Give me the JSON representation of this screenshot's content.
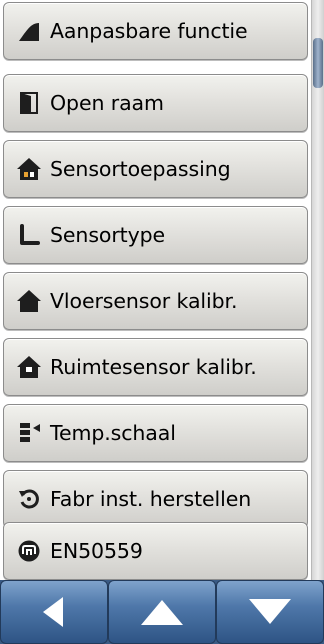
{
  "menu": {
    "items": [
      {
        "label": "Aanpasbare functie",
        "icon": "custom-function-icon"
      },
      {
        "label": "Open raam",
        "icon": "open-window-icon"
      },
      {
        "label": "Sensortoepassing",
        "icon": "house-sensor-icon"
      },
      {
        "label": "Sensortype",
        "icon": "sensor-type-icon"
      },
      {
        "label": "Vloersensor kalibr.",
        "icon": "floor-sensor-house-icon"
      },
      {
        "label": "Ruimtesensor kalibr.",
        "icon": "room-sensor-house-icon"
      },
      {
        "label": "Temp.schaal",
        "icon": "temperature-scale-icon"
      },
      {
        "label": "Fabr inst. herstellen",
        "icon": "factory-reset-icon"
      },
      {
        "label": "EN50559",
        "icon": "en50559-icon"
      }
    ]
  },
  "nav": {
    "back": "arrow-left-icon",
    "up": "arrow-up-icon",
    "down": "arrow-down-icon"
  },
  "colors": {
    "button_face": "#e2e1dd",
    "nav_blue": "#4f78aa",
    "icon_dark": "#1e1e1e",
    "scroll_thumb": "#6f84a0"
  }
}
